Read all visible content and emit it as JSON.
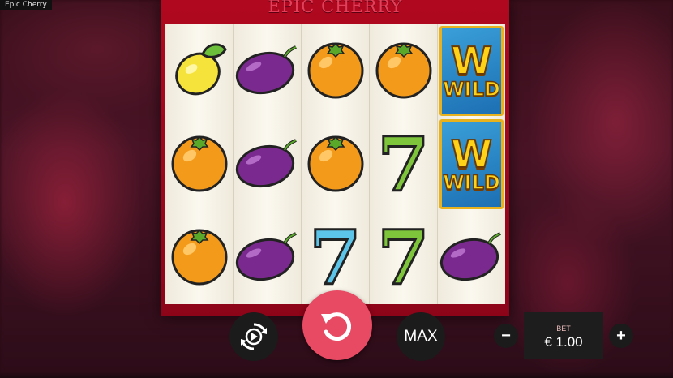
{
  "window": {
    "title": "Epic Cherry"
  },
  "game": {
    "title": "EPIC CHERRY"
  },
  "reels": [
    [
      "lemon",
      "orange",
      "orange"
    ],
    [
      "plum",
      "plum",
      "plum"
    ],
    [
      "orange",
      "orange",
      "seven-blue"
    ],
    [
      "orange",
      "seven-green",
      "seven-green"
    ],
    [
      "wild",
      "wild",
      "plum"
    ]
  ],
  "symbols": {
    "seven": "7",
    "wild_letter": "W",
    "wild_text": "WILD"
  },
  "controls": {
    "max_label": "MAX",
    "minus_label": "−",
    "plus_label": "+",
    "bet_label": "BET",
    "bet_value": "€ 1.00"
  },
  "colors": {
    "machine_red": "#b0081f",
    "spin_button": "#e84a63",
    "wild_gold": "#ffd21a",
    "wild_blue": "#2a88c6"
  }
}
